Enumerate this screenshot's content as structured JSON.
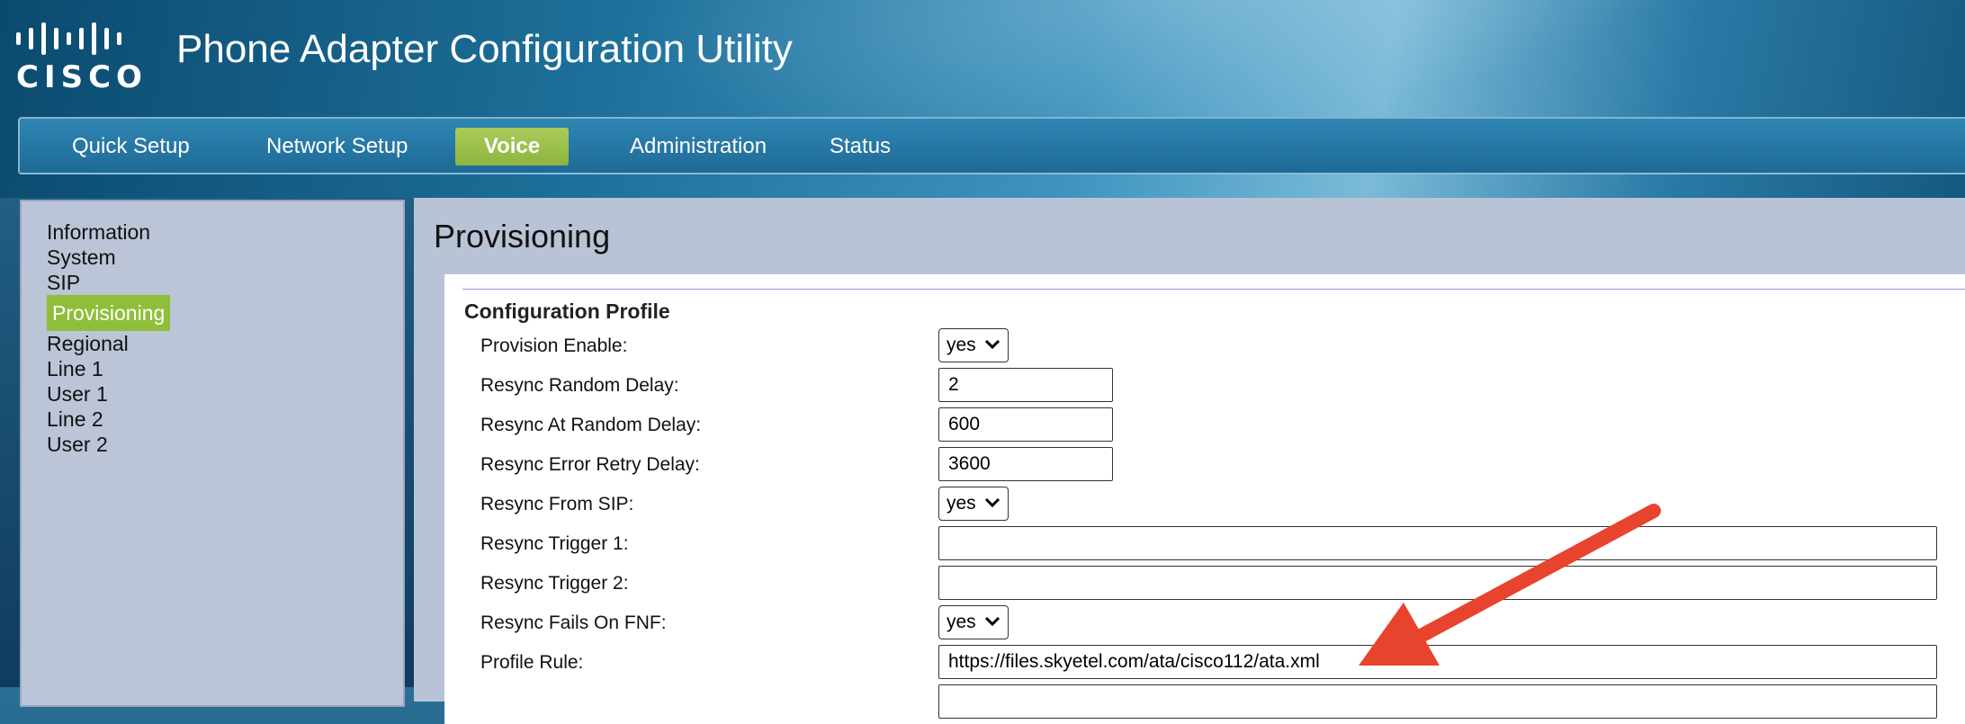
{
  "brand": {
    "logo_text": "CISCO",
    "accent": "#8fbf3a"
  },
  "app": {
    "title": "Phone Adapter Configuration Utility"
  },
  "nav": {
    "tabs": [
      {
        "label": "Quick Setup"
      },
      {
        "label": "Network Setup"
      },
      {
        "label": "Voice",
        "active": true
      },
      {
        "label": "Administration"
      },
      {
        "label": "Status"
      }
    ]
  },
  "sidebar": {
    "items": [
      {
        "label": "Information"
      },
      {
        "label": "System"
      },
      {
        "label": "SIP"
      },
      {
        "label": "Provisioning",
        "active": true
      },
      {
        "label": "Regional"
      },
      {
        "label": "Line 1"
      },
      {
        "label": "User 1"
      },
      {
        "label": "Line 2"
      },
      {
        "label": "User 2"
      }
    ]
  },
  "main": {
    "page_title": "Provisioning",
    "section_title": "Configuration Profile",
    "fields": [
      {
        "label": "Provision Enable:",
        "type": "select",
        "value": "yes"
      },
      {
        "label": "Resync Random Delay:",
        "type": "input",
        "value": "2"
      },
      {
        "label": "Resync At Random Delay:",
        "type": "input",
        "value": "600"
      },
      {
        "label": "Resync Error Retry Delay:",
        "type": "input",
        "value": "3600"
      },
      {
        "label": "Resync From SIP:",
        "type": "select",
        "value": "yes"
      },
      {
        "label": "Resync Trigger 1:",
        "type": "input",
        "value": ""
      },
      {
        "label": "Resync Trigger 2:",
        "type": "input",
        "value": ""
      },
      {
        "label": "Resync Fails On FNF:",
        "type": "select",
        "value": "yes"
      },
      {
        "label": "Profile Rule:",
        "type": "input",
        "value": "https://files.skyetel.com/ata/cisco112/ata.xml"
      }
    ]
  },
  "annotation": {
    "arrow_color": "#e8432d"
  }
}
